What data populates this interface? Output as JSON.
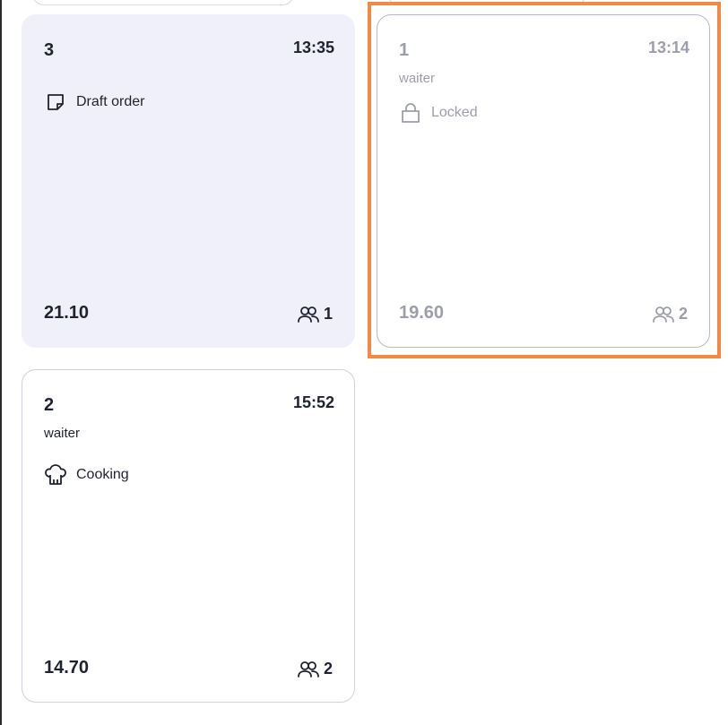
{
  "orders": [
    {
      "number": "3",
      "time": "13:35",
      "waiter": "",
      "status": "Draft order",
      "status_icon": "draft-note-icon",
      "total": "21.10",
      "guests": "1"
    },
    {
      "number": "1",
      "time": "13:14",
      "waiter": "waiter",
      "status": "Locked",
      "status_icon": "lock-icon",
      "total": "19.60",
      "guests": "2",
      "selected": true
    },
    {
      "number": "2",
      "time": "15:52",
      "waiter": "waiter",
      "status": "Cooking",
      "status_icon": "chef-hat-icon",
      "total": "14.70",
      "guests": "2"
    }
  ],
  "colors": {
    "draft_bg": "#eff0f9",
    "highlight": "#f28a44",
    "muted_text": "#9c9eab",
    "text": "#1f2230"
  }
}
